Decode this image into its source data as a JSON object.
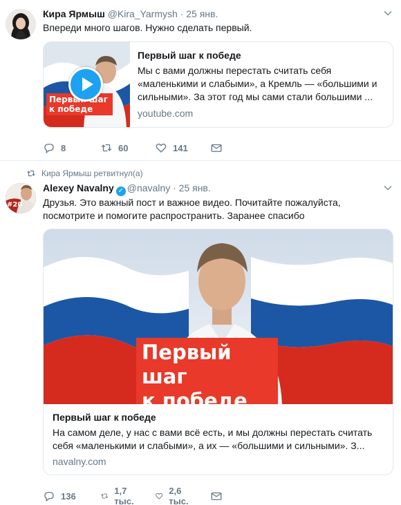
{
  "tweet1": {
    "author_name": "Кира Ярмыш",
    "handle": "@Kira_Yarmysh",
    "separator": "·",
    "time": "25 янв.",
    "text": "Впереди много шагов. Нужно сделать первый.",
    "card": {
      "title": "Первый шаг к победе",
      "description": "Мы с вами должны перестать считать себя «маленькими и слабыми», а Кремль — «большими и сильными». За этот год мы сами стали большими ...",
      "domain": "youtube.com",
      "thumb_banner": "Первый шаг к победе"
    },
    "actions": {
      "replies": "8",
      "retweets": "60",
      "likes": "141"
    }
  },
  "retweet_note": "Кира Ярмыш ретвитнул(а)",
  "tweet2": {
    "author_name": "Alexey Navalny",
    "verified_icon": "verified-badge-icon",
    "handle": "@navalny",
    "separator": "·",
    "time": "25 янв.",
    "avatar_badge": "#20",
    "text": "Друзья. Это важный пост и важное видео. Почитайте пожалуйста, посмотрите и помогите распространить. Заранее спасибо",
    "card": {
      "title": "Первый шаг к победе",
      "description": "На самом деле, у нас с вами всё есть, и мы должны перестать считать себя «маленькими и слабыми», а их — «большими и сильными». З...",
      "domain": "navalny.com",
      "banner_line1": "Первый шаг",
      "banner_line2": "к победе"
    },
    "actions": {
      "replies": "136",
      "retweets": "1,7 тыс.",
      "likes": "2,6 тыс."
    }
  },
  "colors": {
    "accent": "#1da1f2",
    "muted": "#657786",
    "banner_red": "#e8392a",
    "flag_blue": "#1c57a5",
    "flag_red": "#d52b1e"
  }
}
